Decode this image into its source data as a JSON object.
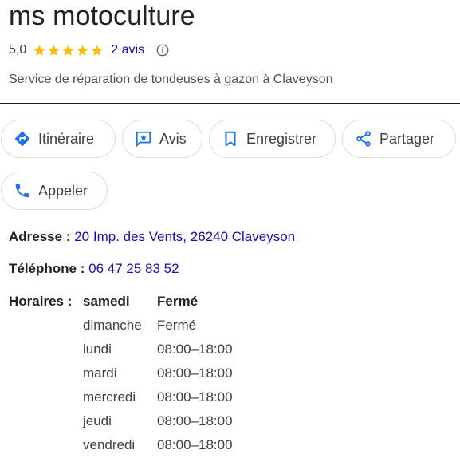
{
  "business": {
    "name": "ms motoculture",
    "rating": "5,0",
    "stars": 5,
    "reviews": "2 avis",
    "category": "Service de réparation de tondeuses à gazon à Claveyson"
  },
  "actions": {
    "directions": "Itinéraire",
    "reviews": "Avis",
    "save": "Enregistrer",
    "share": "Partager",
    "call": "Appeler"
  },
  "address": {
    "label": "Adresse :",
    "value": "20 Imp. des Vents, 26240 Claveyson"
  },
  "phone": {
    "label": "Téléphone :",
    "value": "06 47 25 83 52"
  },
  "hours": {
    "label": "Horaires :",
    "rows": [
      {
        "day": "samedi",
        "time": "Fermé"
      },
      {
        "day": "dimanche",
        "time": "Fermé"
      },
      {
        "day": "lundi",
        "time": "08:00–18:00"
      },
      {
        "day": "mardi",
        "time": "08:00–18:00"
      },
      {
        "day": "mercredi",
        "time": "08:00–18:00"
      },
      {
        "day": "jeudi",
        "time": "08:00–18:00"
      },
      {
        "day": "vendredi",
        "time": "08:00–18:00"
      }
    ]
  },
  "colors": {
    "link": "#1a0dab",
    "star": "#fbbc04",
    "accent_blue": "#1a73e8"
  },
  "icons": {
    "directions": "directions-diamond-icon",
    "reviews": "review-star-icon",
    "save": "bookmark-icon",
    "share": "share-icon",
    "call": "phone-icon",
    "info": "info-circle-icon"
  }
}
